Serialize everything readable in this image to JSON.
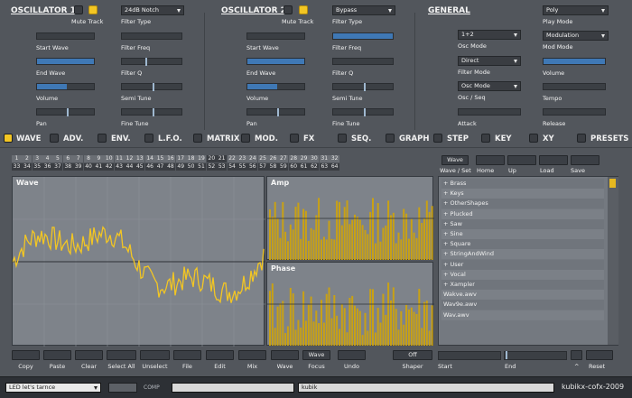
{
  "osc1": {
    "title": "OSCILLATOR 1",
    "mute_label": "Mute Track",
    "filter_type_value": "24dB Notch",
    "labels": [
      "Start Wave",
      "End Wave",
      "Volume",
      "Pan"
    ],
    "right_labels": [
      "Filter Type",
      "Filter Freq",
      "Filter Q",
      "Semi Tune",
      "Fine Tune"
    ]
  },
  "osc2": {
    "title": "OSCILLATOR 2",
    "mute_label": "Mute Track",
    "filter_type_value": "Bypass",
    "labels": [
      "Start Wave",
      "End Wave",
      "Volume",
      "Pan"
    ],
    "right_labels": [
      "Filter Type",
      "Filter Freq",
      "Filter Q",
      "Semi Tune",
      "Fine Tune"
    ]
  },
  "general": {
    "title": "GENERAL",
    "osc_mode_value": "1+2",
    "osc_mode_label": "Osc Mode",
    "filter_mode_value": "Direct",
    "filter_mode_label": "Filter Mode",
    "osc_seq_value": "Osc Mode",
    "osc_seq_label": "Osc / Seq",
    "attack_label": "Attack",
    "play_mode_value": "Poly",
    "play_mode_label": "Play Mode",
    "mod_mode_value": "Modulation",
    "mod_mode_label": "Mod Mode",
    "volume_label": "Volume",
    "tempo_label": "Tempo",
    "release_label": "Release"
  },
  "tabs": [
    "WAVE",
    "ADV.",
    "ENV.",
    "L.F.O.",
    "MATRIX",
    "MOD.",
    "FX",
    "SEQ.",
    "GRAPH",
    "STEP",
    "KEY",
    "XY",
    "PRESETS"
  ],
  "numbers_top": [
    "1",
    "2",
    "3",
    "4",
    "5",
    "6",
    "7",
    "8",
    "9",
    "10",
    "11",
    "12",
    "13",
    "14",
    "15",
    "16",
    "17",
    "18",
    "19",
    "20",
    "21",
    "22",
    "23",
    "24",
    "25",
    "26",
    "27",
    "28",
    "29",
    "30",
    "31",
    "32"
  ],
  "numbers_bottom": [
    "33",
    "34",
    "35",
    "36",
    "37",
    "38",
    "39",
    "40",
    "41",
    "42",
    "43",
    "44",
    "45",
    "46",
    "47",
    "48",
    "49",
    "50",
    "51",
    "52",
    "53",
    "54",
    "55",
    "56",
    "57",
    "58",
    "59",
    "60",
    "61",
    "62",
    "63",
    "64"
  ],
  "panels": {
    "wave": "Wave",
    "amp": "Amp",
    "phase": "Phase"
  },
  "browser": {
    "wave_button": "Wave",
    "wave_set_label": "Wave / Set",
    "nav_labels": [
      "Home",
      "Up",
      "Load",
      "Save"
    ],
    "items": [
      "+ Brass",
      "+ Keys",
      "+ OtherShapes",
      "+ Plucked",
      "+ Saw",
      "+ Sine",
      "+ Square",
      "+ StringAndWind",
      "+ User",
      "+ Vocal",
      "+ Xampler",
      "Wakve.awv",
      "Wav9e.awv",
      "Wav.awv"
    ]
  },
  "bottom": {
    "buttons": [
      "Copy",
      "Paste",
      "Clear",
      "Select All",
      "Unselect",
      "File",
      "Edit",
      "Mix",
      "Wave",
      "Focus",
      "Undo",
      "Shaper"
    ],
    "focus_value": "Wave",
    "shaper_value": "Off",
    "start_label": "Start",
    "end_label": "End",
    "caret": "^",
    "reset_label": "Reset"
  },
  "status": {
    "preset_value": "LED let's tarnce",
    "comp_label": "COMP",
    "name_value": "kubik",
    "brand": "kubikx-cofx-2009"
  },
  "colors": {
    "accent": "#f3c623",
    "slider": "#3f78b5",
    "panel": "#7e838a",
    "background": "#52565c"
  }
}
